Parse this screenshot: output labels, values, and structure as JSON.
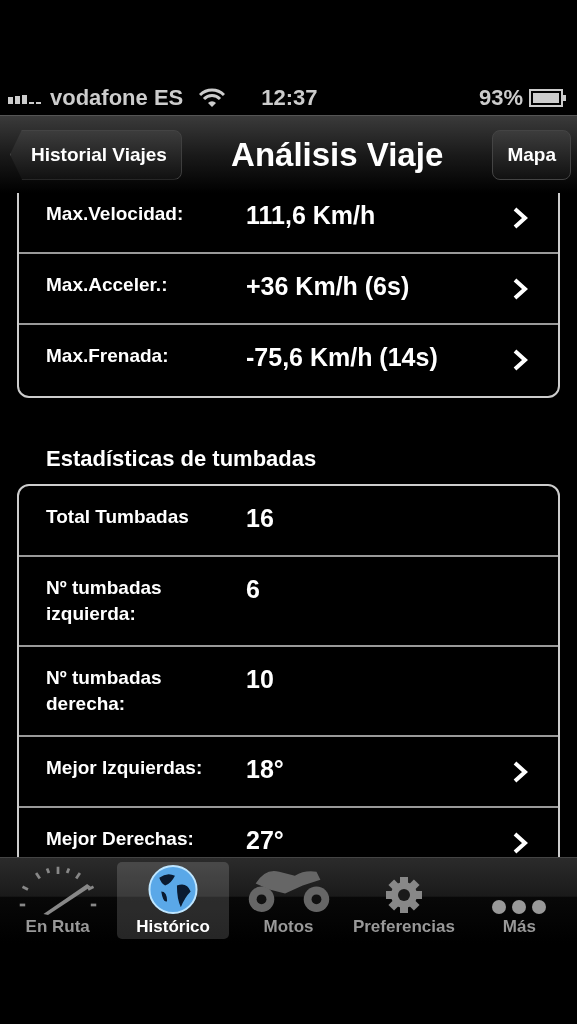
{
  "status_bar": {
    "carrier": "vodafone ES",
    "time": "12:37",
    "battery": "93%"
  },
  "nav_bar": {
    "back": "Historial Viajes",
    "title": "Análisis Viaje",
    "right": "Mapa"
  },
  "groups": [
    {
      "rows": [
        {
          "label": "Max.Velocidad:",
          "value": "111,6 Km/h",
          "disclosure": true
        },
        {
          "label": "Max.Acceler.:",
          "value": "+36 Km/h (6s)",
          "disclosure": true
        },
        {
          "label": "Max.Frenada:",
          "value": "-75,6 Km/h (14s)",
          "disclosure": true
        }
      ]
    },
    {
      "header": "Estadísticas de tumbadas",
      "rows": [
        {
          "label": "Total Tumbadas",
          "value": "16",
          "disclosure": false
        },
        {
          "label": "Nº tumbadas izquierda:",
          "value": "6",
          "disclosure": false
        },
        {
          "label": "Nº tumbadas derecha:",
          "value": "10",
          "disclosure": false
        },
        {
          "label": "Mejor Izquierdas:",
          "value": "18°",
          "disclosure": true
        },
        {
          "label": "Mejor Derechas:",
          "value": "27°",
          "disclosure": true
        }
      ]
    }
  ],
  "tab_bar": [
    {
      "label": "En Ruta",
      "selected": false
    },
    {
      "label": "Histórico",
      "selected": true
    },
    {
      "label": "Motos",
      "selected": false
    },
    {
      "label": "Preferencias",
      "selected": false
    },
    {
      "label": "Más",
      "selected": false
    }
  ]
}
